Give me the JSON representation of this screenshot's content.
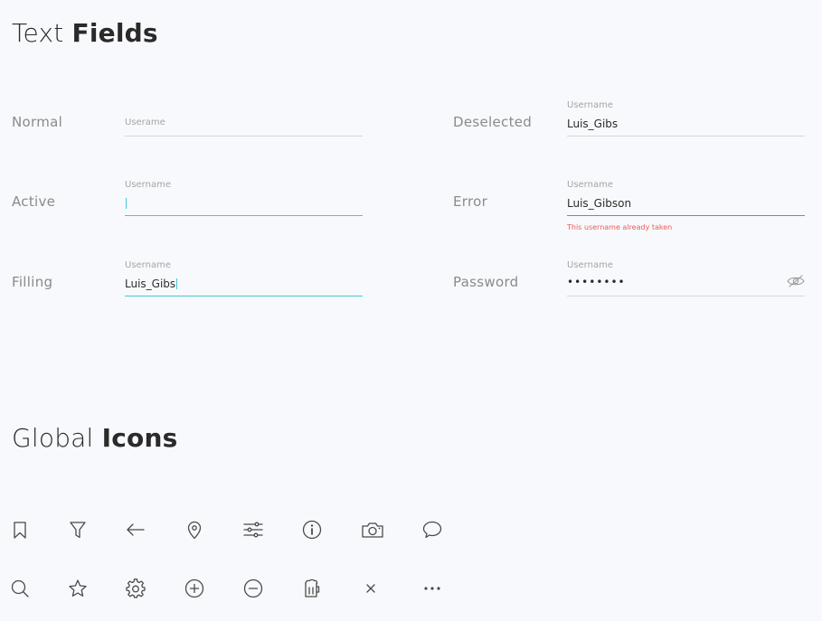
{
  "text_fields": {
    "title_light": "Text",
    "title_bold": "Fields",
    "left": [
      {
        "state": "Normal",
        "label": "",
        "value": "Userame"
      },
      {
        "state": "Active",
        "label": "Username",
        "value": ""
      },
      {
        "state": "Filling",
        "label": "Username",
        "value": "Luis_Gibs"
      }
    ],
    "right": [
      {
        "state": "Deselected",
        "label": "Username",
        "value": "Luis_Gibs"
      },
      {
        "state": "Error",
        "label": "Username",
        "value": "Luis_Gibson",
        "error": "This username already taken"
      },
      {
        "state": "Password",
        "label": "Username",
        "value": "••••••••"
      }
    ]
  },
  "global_icons": {
    "title_light": "Global",
    "title_bold": "Icons",
    "row1": [
      "bookmark-icon",
      "filter-icon",
      "arrow-left-icon",
      "location-pin-icon",
      "sliders-icon",
      "info-icon",
      "camera-icon",
      "chat-bubble-icon"
    ],
    "row2": [
      "search-icon",
      "star-icon",
      "gear-icon",
      "plus-circle-icon",
      "minus-circle-icon",
      "beer-mug-icon",
      "close-icon",
      "more-horizontal-icon"
    ]
  },
  "colors": {
    "active": "#45c6d6",
    "error": "#ee5a5a",
    "divider": "#d6d6d6",
    "muted_text": "#8a8a8a",
    "background": "#f8f9fc"
  }
}
